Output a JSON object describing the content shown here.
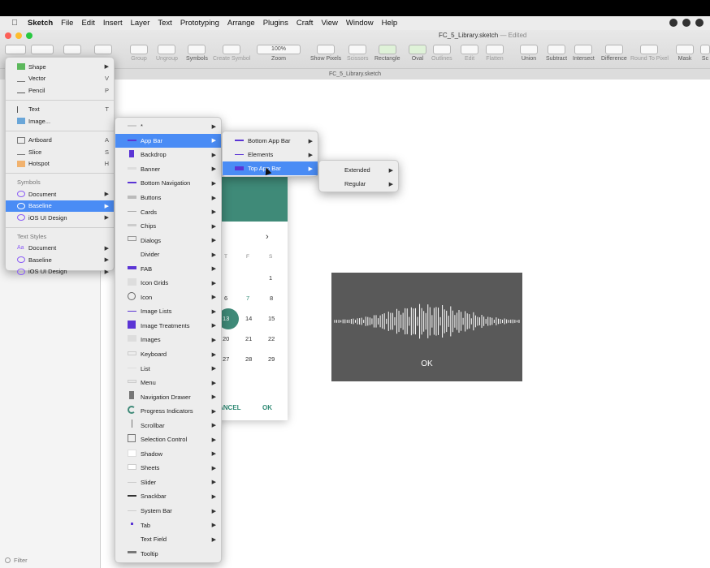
{
  "menubar": {
    "app": "Sketch",
    "items": [
      "File",
      "Edit",
      "Insert",
      "Layer",
      "Text",
      "Prototyping",
      "Arrange",
      "Plugins",
      "Craft",
      "View",
      "Window",
      "Help"
    ]
  },
  "window": {
    "doc_title": "FC_5_Library.sketch",
    "edited": "— Edited",
    "tab_title": "FC_5_Library.sketch"
  },
  "toolbar": {
    "zoom_value": "100%",
    "tools": [
      "Group",
      "Ungroup",
      "Symbols",
      "Create Symbol",
      "Zoom",
      "Show Pixels",
      "Scissors",
      "Rectangle",
      "Oval",
      "Outlines",
      "Edit",
      "Flatten",
      "Union",
      "Subtract",
      "Intersect",
      "Difference",
      "Round To Pixel",
      "Mask",
      "Sc"
    ]
  },
  "sidebar": {
    "filter": "Filter"
  },
  "insert_menu": {
    "items": [
      {
        "label": "Shape",
        "arrow": "▶"
      },
      {
        "label": "Vector",
        "shortcut": "V"
      },
      {
        "label": "Pencil",
        "shortcut": "P"
      },
      {
        "label": "Text",
        "shortcut": "T"
      },
      {
        "label": "Image..."
      },
      {
        "label": "Artboard",
        "shortcut": "A"
      },
      {
        "label": "Slice",
        "shortcut": "S"
      },
      {
        "label": "Hotspot",
        "shortcut": "H"
      }
    ],
    "symbols_header": "Symbols",
    "symbols": [
      "Document",
      "Baseline",
      "iOS UI Design"
    ],
    "textstyles_header": "Text Styles",
    "textstyles": [
      "Document",
      "Baseline",
      "iOS UI Design"
    ]
  },
  "baseline_menu": {
    "items": [
      "*",
      "App Bar",
      "Backdrop",
      "Banner",
      "Bottom Navigation",
      "Buttons",
      "Cards",
      "Chips",
      "Dialogs",
      "Divider",
      "FAB",
      "Icon Grids",
      "Icon",
      "Image Lists",
      "Image Treatments",
      "Images",
      "Keyboard",
      "List",
      "Menu",
      "Navigation Drawer",
      "Progress Indicators",
      "Scrollbar",
      "Selection Control",
      "Shadow",
      "Sheets",
      "Slider",
      "Snackbar",
      "System Bar",
      "Tab",
      "Text Field",
      "Tooltip"
    ]
  },
  "appbar_menu": {
    "items": [
      "Bottom App Bar",
      "Elements",
      "Top App Bar"
    ]
  },
  "topappbar_menu": {
    "items": [
      "Extended",
      "Regular"
    ]
  },
  "calendar": {
    "chevron": "›",
    "headers": [
      "T",
      "F",
      "S"
    ],
    "rows": [
      [
        "",
        "",
        "1"
      ],
      [
        "6",
        "7",
        "8"
      ],
      [
        "13",
        "14",
        "15"
      ],
      [
        "20",
        "21",
        "22"
      ],
      [
        "27",
        "28",
        "29"
      ]
    ],
    "cancel": "ANCEL",
    "ok": "OK"
  },
  "audio": {
    "ok": "OK"
  },
  "colors": {
    "accent": "#4a8cf5",
    "teal": "#3f8a78",
    "purple": "#5b35d5"
  }
}
